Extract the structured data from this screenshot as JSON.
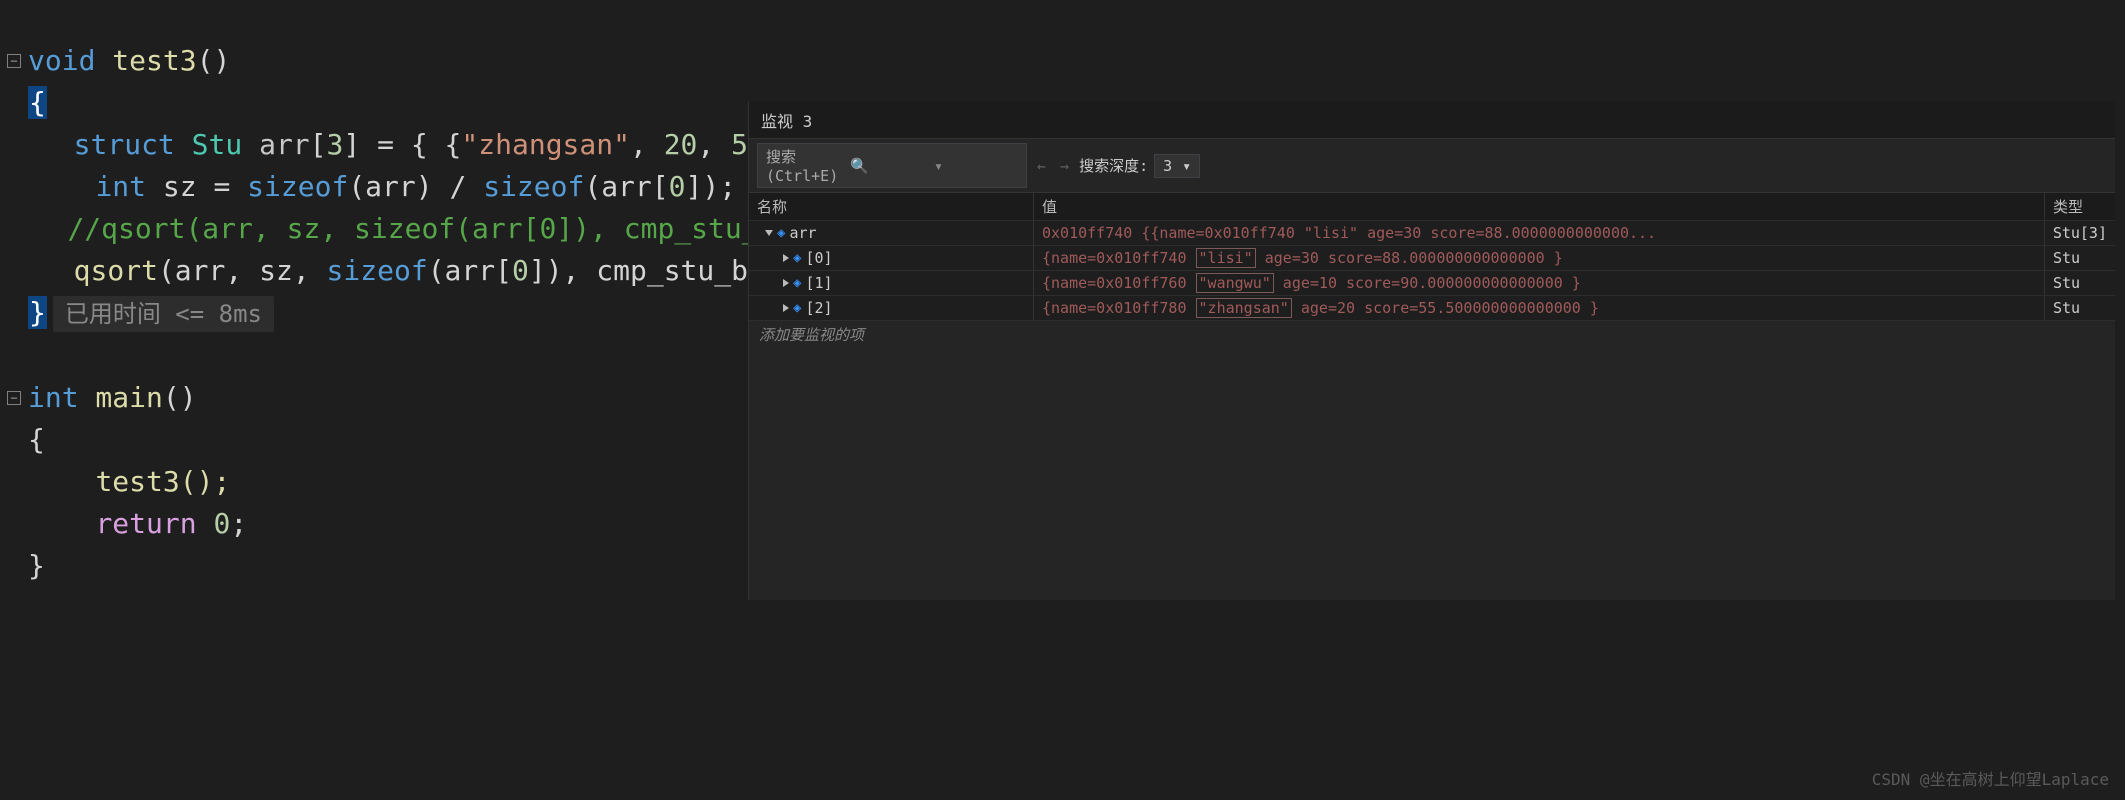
{
  "editor": {
    "lines": {
      "l1_void": "void",
      "l1_sp": " ",
      "l1_fn": "test3",
      "l1_p": "()",
      "l2_brace": "{",
      "l3_kw": "struct",
      "l3_cls": " Stu ",
      "l3_var": "arr",
      "l3_b1": "[",
      "l3_n1": "3",
      "l3_b2": "] = { {",
      "l3_s1": "\"zhangsan\"",
      "l3_c1": ", ",
      "l3_n2": "20",
      "l3_c2": ", ",
      "l3_n3": "5",
      "l4_t": "int",
      "l4_var": " sz = ",
      "l4_fn1": "sizeof",
      "l4_p1": "(arr) / ",
      "l4_fn2": "sizeof",
      "l4_p2": "(arr[",
      "l4_n0": "0",
      "l4_p3": "]);",
      "l5_comment": "//qsort(arr, sz, sizeof(arr[0]), cmp_stu_",
      "l6_fn": "qsort",
      "l6_p1": "(arr, sz, ",
      "l6_fn2": "sizeof",
      "l6_p2": "(arr[",
      "l6_n0": "0",
      "l6_p3": "]), cmp_stu_b",
      "l7_brace": "}",
      "hint": "已用时间 <= 8ms",
      "l9_t": "int",
      "l9_fn": " main",
      "l9_p": "()",
      "l10_brace": "{",
      "l11_call": "test3();",
      "l12_ret": "return",
      "l12_v": " 0",
      "l12_s": ";",
      "l13_brace": "}"
    }
  },
  "watch": {
    "title": "监视 3",
    "search_placeholder": "搜索(Ctrl+E)",
    "depth_label": "搜索深度:",
    "depth_value": "3",
    "headers": {
      "name": "名称",
      "value": "值",
      "type": "类型"
    },
    "rows": [
      {
        "indent": 0,
        "expanded": true,
        "name": "arr",
        "value_pre": "0x010ff740 {{name=0x010ff740 \"lisi\" age=30 score=88.0000000000000...",
        "boxed": "",
        "value_post": "",
        "type": "Stu[3]"
      },
      {
        "indent": 1,
        "expanded": false,
        "name": "[0]",
        "value_pre": "{name=0x010ff740 ",
        "boxed": "\"lisi\"",
        "value_post": " age=30 score=88.000000000000000 }",
        "type": "Stu"
      },
      {
        "indent": 1,
        "expanded": false,
        "name": "[1]",
        "value_pre": "{name=0x010ff760 ",
        "boxed": "\"wangwu\"",
        "value_post": " age=10 score=90.000000000000000 }",
        "type": "Stu"
      },
      {
        "indent": 1,
        "expanded": false,
        "name": "[2]",
        "value_pre": "{name=0x010ff780 ",
        "boxed": "\"zhangsan\"",
        "value_post": " age=20 score=55.500000000000000 }",
        "type": "Stu"
      }
    ],
    "add_item": "添加要监视的项"
  },
  "watermark": "CSDN @坐在高树上仰望Laplace"
}
